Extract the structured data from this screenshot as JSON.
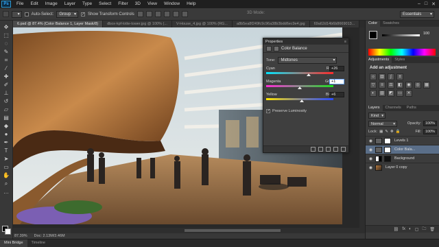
{
  "menubar": {
    "logo": "Ps",
    "items": [
      "File",
      "Edit",
      "Image",
      "Layer",
      "Type",
      "Select",
      "Filter",
      "3D",
      "View",
      "Window",
      "Help"
    ],
    "window_controls": [
      "–",
      "□",
      "✕"
    ]
  },
  "options": {
    "auto_select_label": "Auto-Select:",
    "auto_select_value": "Group",
    "show_transform_label": "Show Transform Controls",
    "mode_3d_label": "3D Mode:",
    "workspace": "Essentials"
  },
  "tabs": [
    "6.psd @ 87.4% (Color Balance 1, Layer Mask/8)",
    "dbox-kpf-lotte-tower.jpg @ 100% (...",
    "V-House_4.jpg @ 100% (RG...",
    "a8b5ea8f249fc9c96a38b3bdd6ec9e4.jpg",
    "69a62d14b6b8669013..."
  ],
  "status": {
    "zoom": "87.39%",
    "doc": "Doc: 2.13M/3.46M"
  },
  "bottom_tabs": [
    "Mini Bridge",
    "Timeline"
  ],
  "properties": {
    "header": "Properties",
    "title": "Color Balance",
    "tone_label": "Tone:",
    "tone_value": "Midtones",
    "sliders": [
      {
        "left": "Cyan",
        "right": "Red",
        "value": "+26",
        "amount": 26,
        "gradient": [
          "#00e5ff",
          "#ff2a2a"
        ]
      },
      {
        "left": "Magenta",
        "right": "Green",
        "value": "+1",
        "amount": 1,
        "gradient": [
          "#ff2bd6",
          "#1ee01e"
        ]
      },
      {
        "left": "Yellow",
        "right": "Blue",
        "value": "+6",
        "amount": 6,
        "gradient": [
          "#ffe600",
          "#2a4bff"
        ]
      }
    ],
    "preserve_label": "Preserve Luminosity"
  },
  "color_panel": {
    "tabs": [
      "Color",
      "Swatches"
    ],
    "value": "100"
  },
  "adjustments": {
    "tabs": [
      "Adjustments",
      "Styles"
    ],
    "title": "Add an adjustment"
  },
  "layers": {
    "tabs": [
      "Layers",
      "Channels",
      "Paths"
    ],
    "filter_label": "Kind",
    "blend_mode": "Normal",
    "opacity_label": "Opacity:",
    "opacity_value": "100%",
    "lock_label": "Lock:",
    "fill_label": "Fill:",
    "fill_value": "100%",
    "items": [
      {
        "name": "Levels 1",
        "selected": false
      },
      {
        "name": "Color Bala...",
        "selected": true
      },
      {
        "name": "Background",
        "selected": false
      },
      {
        "name": "Layer 0 copy",
        "selected": false
      }
    ],
    "foot_icons": [
      "⛓",
      "fx",
      "◐",
      "▢",
      "🗀",
      "🗑"
    ]
  },
  "colors": {
    "accent": "#31a8ff",
    "selection": "#5a6e88"
  }
}
